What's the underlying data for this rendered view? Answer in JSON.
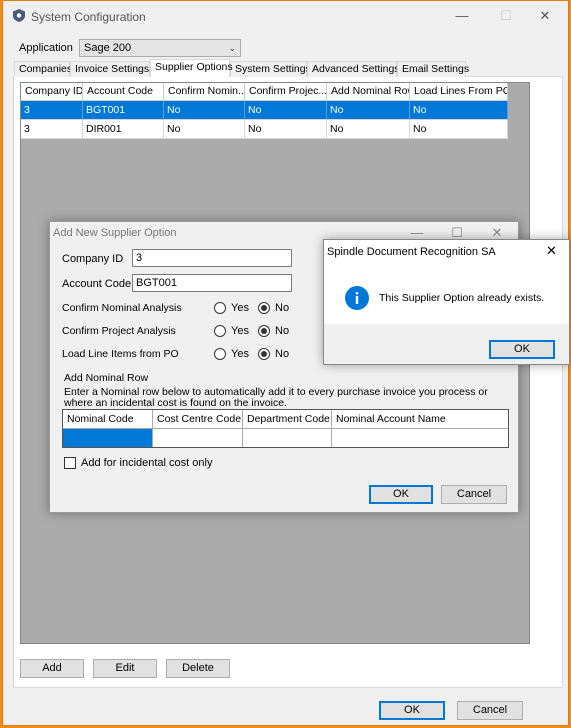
{
  "window": {
    "title": "System Configuration",
    "minimize": "—",
    "maximize": "☐",
    "close": "✕"
  },
  "application": {
    "label": "Application",
    "value": "Sage 200"
  },
  "tabs": [
    "Companies",
    "Invoice Settings",
    "Supplier Options",
    "System Settings",
    "Advanced Settings",
    "Email Settings"
  ],
  "grid": {
    "columns": [
      "Company ID",
      "Account Code",
      "Confirm Nomin...",
      "Confirm Projec...",
      "Add Nominal Row",
      "Load Lines From PO"
    ],
    "rows": [
      [
        "3",
        "BGT001",
        "No",
        "No",
        "No",
        "No"
      ],
      [
        "3",
        "DIR001",
        "No",
        "No",
        "No",
        "No"
      ]
    ]
  },
  "actions": {
    "add": "Add",
    "edit": "Edit",
    "delete": "Delete"
  },
  "footer": {
    "ok": "OK",
    "cancel": "Cancel"
  },
  "dialog": {
    "title": "Add New Supplier Option",
    "company_id_label": "Company ID",
    "company_id": "3",
    "account_code_label": "Account Code",
    "account_code": "BGT001",
    "confirm_nominal_label": "Confirm Nominal Analysis",
    "confirm_project_label": "Confirm Project Analysis",
    "load_lines_label": "Load Line Items from PO",
    "yes": "Yes",
    "no": "No",
    "add_nominal_title": "Add Nominal Row",
    "add_nominal_desc1": "Enter a Nominal row below to automatically add it to every purchase invoice you process or",
    "add_nominal_desc2": "where an incidental cost is found on the invoice.",
    "nominal_columns": [
      "Nominal Code",
      "Cost Centre Code",
      "Department Code",
      "Nominal Account Name"
    ],
    "incidental_label": "Add for incidental cost only",
    "ok": "OK",
    "cancel": "Cancel"
  },
  "message": {
    "title": "Spindle Document Recognition SA",
    "text": "This Supplier Option already exists.",
    "ok": "OK",
    "close": "✕"
  },
  "colors": {
    "selection": "#0078d7",
    "window_border": "#f28c1a",
    "info_icon": "#0078d7"
  }
}
